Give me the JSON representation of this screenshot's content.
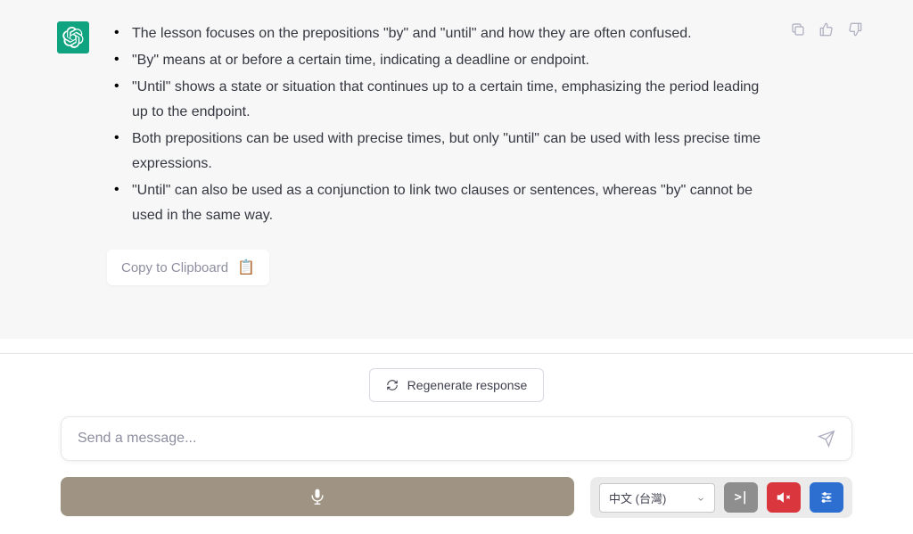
{
  "message": {
    "bullets": [
      "The lesson focuses on the prepositions \"by\" and \"until\" and how they are often confused.",
      "\"By\" means at or before a certain time, indicating a deadline or endpoint.",
      "\"Until\" shows a state or situation that continues up to a certain time, emphasizing the period leading up to the endpoint.",
      "Both prepositions can be used with precise times, but only \"until\" can be used with less precise time expressions.",
      "\"Until\" can also be used as a conjunction to link two clauses or sentences, whereas \"by\" cannot be used in the same way."
    ],
    "copy_label": "Copy to Clipboard",
    "copy_emoji": "📋"
  },
  "regenerate_label": "Regenerate response",
  "input": {
    "placeholder": "Send a message..."
  },
  "toolbar": {
    "language": "中文 (台灣)"
  },
  "icons": {
    "copy_aria": "copy-icon",
    "thumbs_up_aria": "thumbs-up-icon",
    "thumbs_down_aria": "thumbs-down-icon"
  }
}
